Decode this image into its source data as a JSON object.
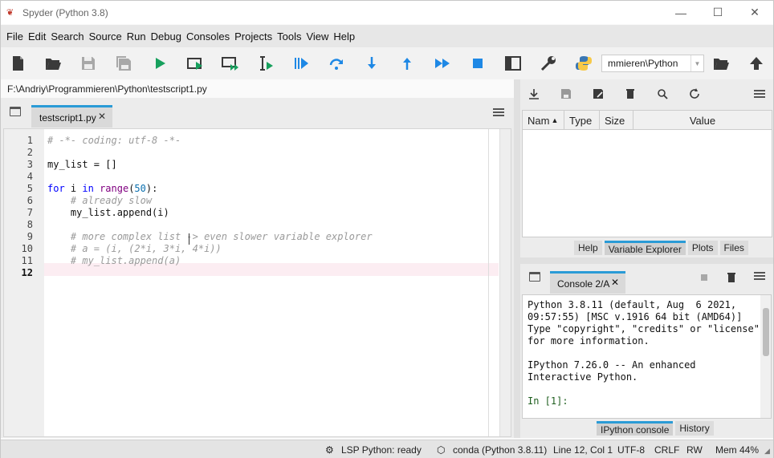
{
  "window": {
    "title": "Spyder (Python 3.8)",
    "icon": "spyder-icon",
    "controls": [
      "—",
      "☐",
      "✕"
    ]
  },
  "menubar": [
    "File",
    "Edit",
    "Search",
    "Source",
    "Run",
    "Debug",
    "Consoles",
    "Projects",
    "Tools",
    "View",
    "Help"
  ],
  "toolbar": {
    "icons": [
      "new-file-icon",
      "open-file-icon",
      "save-icon",
      "save-all-icon",
      "run-icon",
      "run-cell-icon",
      "run-cell-advance-icon",
      "run-selection-icon",
      "debug-icon",
      "step-over-icon",
      "step-into-icon",
      "step-out-icon",
      "continue-icon",
      "stop-icon",
      "maximize-pane-icon",
      "preferences-icon",
      "python-path-icon"
    ],
    "working_dir": "mmieren\\Python"
  },
  "editor": {
    "filepath": "F:\\Andriy\\Programmieren\\Python\\testscript1.py",
    "tab_label": "testscript1.py",
    "tab_close": "✕",
    "current_line": 12,
    "lines": [
      "# -*- coding: utf-8 -*-",
      "",
      "my_list = []",
      "",
      "for i in range(50):",
      "    # already slow",
      "    my_list.append(i)",
      "",
      "    # more complex list -> even slower variable explorer",
      "    # a = (i, (2*i, 3*i, 4*i))",
      "    # my_list.append(a)",
      ""
    ]
  },
  "variable_explorer": {
    "columns": [
      "Nam",
      "Type",
      "Size",
      "Value"
    ],
    "tabs": [
      "Help",
      "Variable Explorer",
      "Plots",
      "Files"
    ],
    "active_tab": "Variable Explorer"
  },
  "console": {
    "tab_label": "Console 2/A",
    "tab_close": "✕",
    "output": [
      "Python 3.8.11 (default, Aug  6 2021,",
      "09:57:55) [MSC v.1916 64 bit (AMD64)]",
      "Type \"copyright\", \"credits\" or \"license\"",
      "for more information.",
      "",
      "IPython 7.26.0 -- An enhanced",
      "Interactive Python.",
      "",
      "In [1]:"
    ],
    "tabs": [
      "IPython console",
      "History"
    ],
    "active_tab": "IPython console"
  },
  "statusbar": {
    "lsp": "LSP Python: ready",
    "env": "conda (Python 3.8.11)",
    "cursor": "Line 12, Col 1",
    "encoding": "UTF-8",
    "eol": "CRLF",
    "rw": "RW",
    "mem": "Mem 44%"
  },
  "colors": {
    "accent": "#2a9bd6",
    "run_blue": "#1e88e5",
    "run_green": "#17a05d",
    "current_line": "#fcedf2"
  }
}
